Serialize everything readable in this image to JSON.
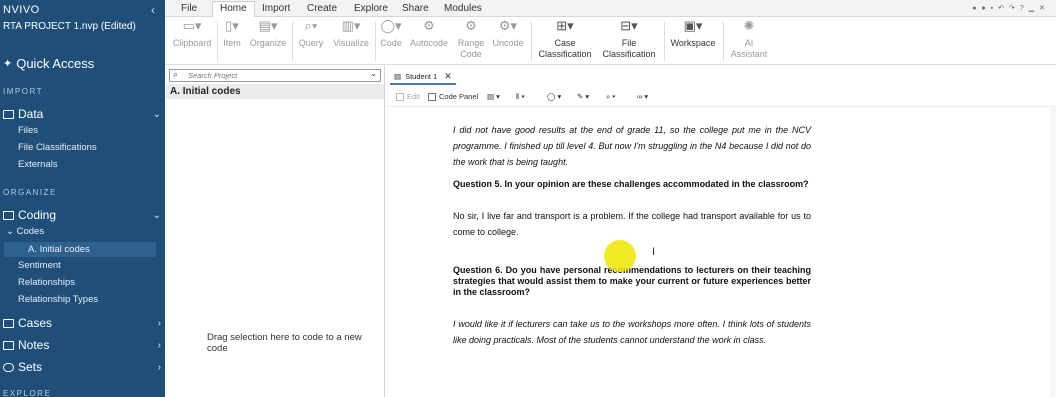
{
  "app": {
    "logo": "NVIVO",
    "project_name": "RTA PROJECT 1.nvp (Edited)"
  },
  "sidebar": {
    "collapse_icon": "chevron-left-icon",
    "quick_access": "Quick Access",
    "sections": {
      "import": "IMPORT",
      "organize": "ORGANIZE",
      "explore": "EXPLORE"
    },
    "data": {
      "label": "Data",
      "items": [
        "Files",
        "File Classifications",
        "Externals"
      ]
    },
    "coding": {
      "label": "Coding",
      "codes_label": "Codes",
      "selected_code": "A. Initial codes",
      "items": [
        "Sentiment",
        "Relationships",
        "Relationship Types"
      ]
    },
    "cases": "Cases",
    "notes": "Notes",
    "sets": "Sets"
  },
  "ribbon": {
    "tabs": [
      "File",
      "Home",
      "Import",
      "Create",
      "Explore",
      "Share",
      "Modules"
    ],
    "active_tab": "Home",
    "buttons": {
      "clipboard": "Clipboard",
      "item": "Item",
      "organize": "Organize",
      "query": "Query",
      "visualize": "Visualize",
      "code": "Code",
      "autocode": "Autocode",
      "range_code": "Range Code",
      "uncode": "Uncode",
      "case_classification": "Case Classification",
      "file_classification": "File Classification",
      "workspace": "Workspace",
      "ai_assistant": "AI Assistant"
    }
  },
  "left_panel": {
    "search_placeholder": "Search Project",
    "header": "A. Initial codes",
    "drag_hint": "Drag selection here to code to a new code"
  },
  "document": {
    "tab_label": "Student 1",
    "toolbar": {
      "edit": "Edit",
      "code_panel": "Code Panel"
    },
    "paragraphs": {
      "p1": "I did not have good results at the end of grade 11, so the college put me in the NCV programme. I finished up till level 4. But now I'm struggling in the N4 because I did not do the work that is being taught.",
      "q5": "Question 5. In your opinion are these challenges accommodated in the classroom?",
      "a5": "No sir, I live far and transport is a problem. If the college had transport available for us to come to college.",
      "q6": "Question 6. Do you have personal recommendations to lecturers on their teaching strategies that would assist them to make your current or future experiences better in the classroom?",
      "a6": "I would like it if lecturers can take us to the workshops more often. I think lots of students like doing practicals. Most of the students cannot understand the work in class."
    }
  },
  "colors": {
    "sidebar_bg": "#1f4e79",
    "selected_row": "#2f618f",
    "cursor_highlight": "#f0e600"
  }
}
